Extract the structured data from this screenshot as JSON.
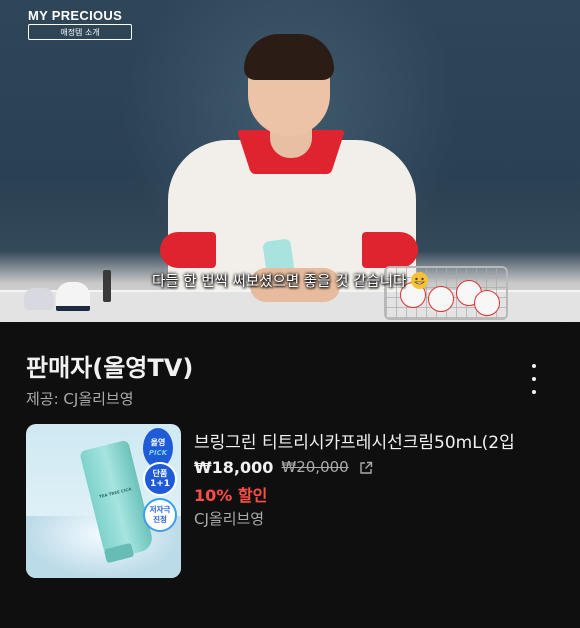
{
  "video": {
    "brand": "MY PRECIOUS",
    "brand_sub": "애정템 소개",
    "caption": "다들 한 번씩 써보셨으면 좋을 것 같습니다"
  },
  "product_panel": {
    "seller": "판매자(올영TV)",
    "provider": "제공: CJ올리브영",
    "product": {
      "name": "브링그린 티트리시카프레시선크림50mL(2입",
      "price": "₩18,000",
      "original_price": "₩20,000",
      "discount": "10% 할인",
      "store": "CJ올리브영",
      "badges": {
        "b1_top": "올영",
        "b1_bottom": "PICK",
        "b2_top": "단품",
        "b2_bottom": "1+1",
        "b3_top": "저자극",
        "b3_bottom": "진정"
      },
      "tube_label": "TEA TREE CICA"
    }
  },
  "colors": {
    "background": "#0f0f0f",
    "discount": "#ff4e45",
    "secondary_text": "#aaaaaa",
    "badge_blue": "#1f5bd8"
  },
  "icons": {
    "more": "more-vert-icon",
    "external": "external-link-icon",
    "caption_emoji": "grinning-face-emoji"
  }
}
